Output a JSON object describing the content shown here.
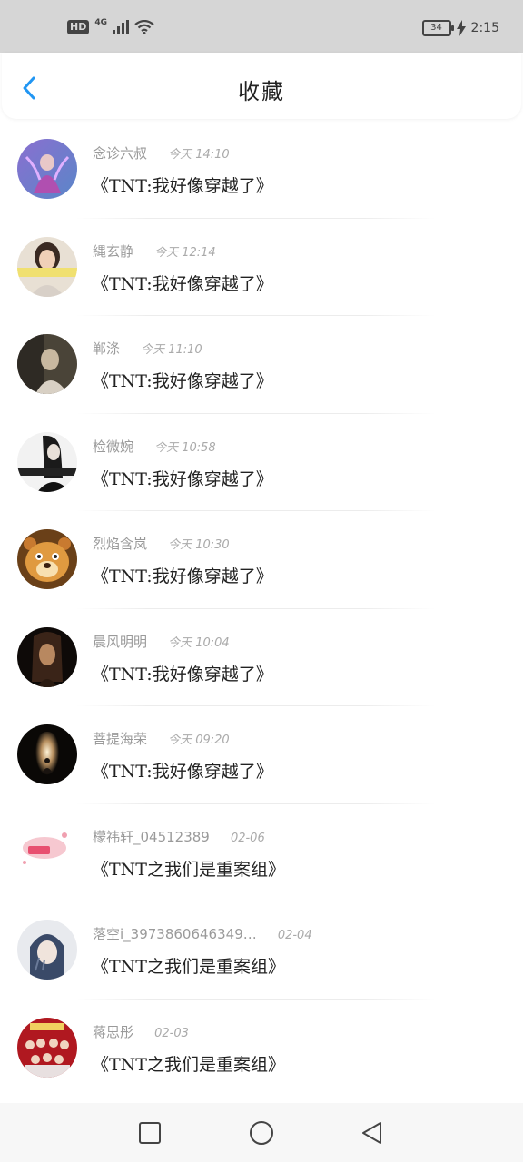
{
  "status_bar": {
    "hd": "HD",
    "network": "4G",
    "battery": "34",
    "time": "2:15",
    "icons": [
      "signal-icon",
      "wifi-icon",
      "charging-icon"
    ]
  },
  "header": {
    "title": "收藏",
    "back_icon": "chevron-left-icon",
    "accent_color": "#2196f3"
  },
  "items": [
    {
      "user": "念诊六叔",
      "time": "今天 14:10",
      "title": "《TNT:我好像穿越了》",
      "avatar": "fantasy-avatar"
    },
    {
      "user": "縄玄静",
      "time": "今天 12:14",
      "title": "《TNT:我好像穿越了》",
      "avatar": "girl-banner-avatar"
    },
    {
      "user": "郸涤",
      "time": "今天 11:10",
      "title": "《TNT:我好像穿越了》",
      "avatar": "dark-photo-avatar"
    },
    {
      "user": "检微婉",
      "time": "今天 10:58",
      "title": "《TNT:我好像穿越了》",
      "avatar": "bw-girl-avatar"
    },
    {
      "user": "烈焰含岚",
      "time": "今天 10:30",
      "title": "《TNT:我好像穿越了》",
      "avatar": "bear-avatar"
    },
    {
      "user": "晨风明明",
      "time": "今天 10:04",
      "title": "《TNT:我好像穿越了》",
      "avatar": "dark-girl-avatar"
    },
    {
      "user": "菩提海荣",
      "time": "今天 09:20",
      "title": "《TNT:我好像穿越了》",
      "avatar": "meditation-avatar"
    },
    {
      "user": "檬祎轩_04512389",
      "time": "02-06",
      "title": "《TNT之我们是重案组》",
      "avatar": "pink-sticker-avatar"
    },
    {
      "user": "落空i_3973860646349…",
      "time": "02-04",
      "title": "《TNT之我们是重案组》",
      "avatar": "hooded-girl-avatar"
    },
    {
      "user": "蒋思彤",
      "time": "02-03",
      "title": "《TNT之我们是重案组》",
      "avatar": "group-red-avatar"
    }
  ],
  "nav": {
    "icons": [
      "recents-square-icon",
      "home-circle-icon",
      "back-triangle-icon"
    ]
  }
}
